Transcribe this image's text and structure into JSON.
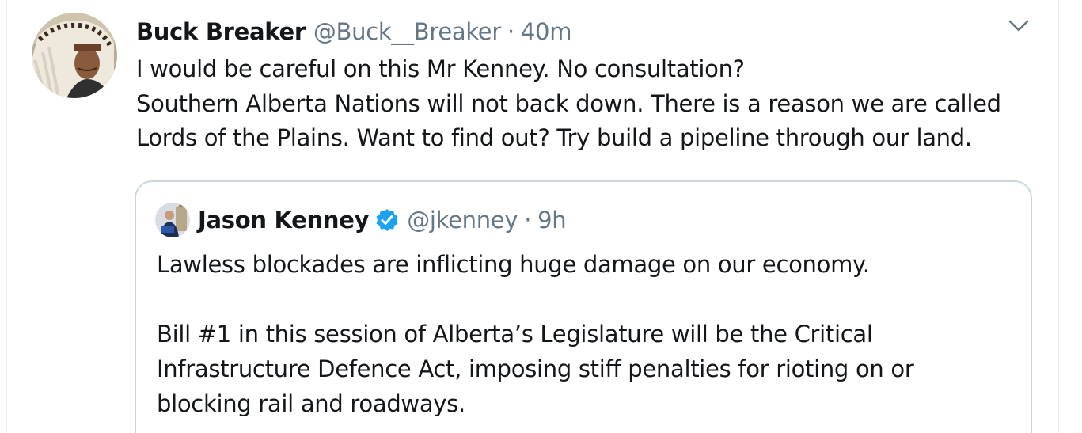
{
  "tweet": {
    "display_name": "Buck Breaker",
    "handle": "@Buck__Breaker",
    "separator": "·",
    "time": "40m",
    "lines": [
      "I would be careful on this Mr Kenney. No consultation?",
      "Southern Alberta Nations will not back down. There is a reason we are called",
      "Lords of the Plains. Want to find out? Try build a pipeline through our land."
    ],
    "menu_icon": "chevron-down-icon"
  },
  "quoted": {
    "display_name": "Jason Kenney",
    "verified_icon": "verified-badge-icon",
    "handle": "@jkenney",
    "separator": "·",
    "time": "9h",
    "paragraph1": "Lawless blockades are inflicting huge damage on our economy.",
    "paragraph2_lines": [
      "Bill #1 in this session of Alberta’s Legislature will be the Critical",
      "Infrastructure Defence Act, imposing stiff penalties for rioting on or",
      "blocking rail and roadways."
    ]
  },
  "colors": {
    "text": "#14171a",
    "secondary": "#657786",
    "border": "#ccd6dd",
    "verified": "#1da1f2"
  }
}
